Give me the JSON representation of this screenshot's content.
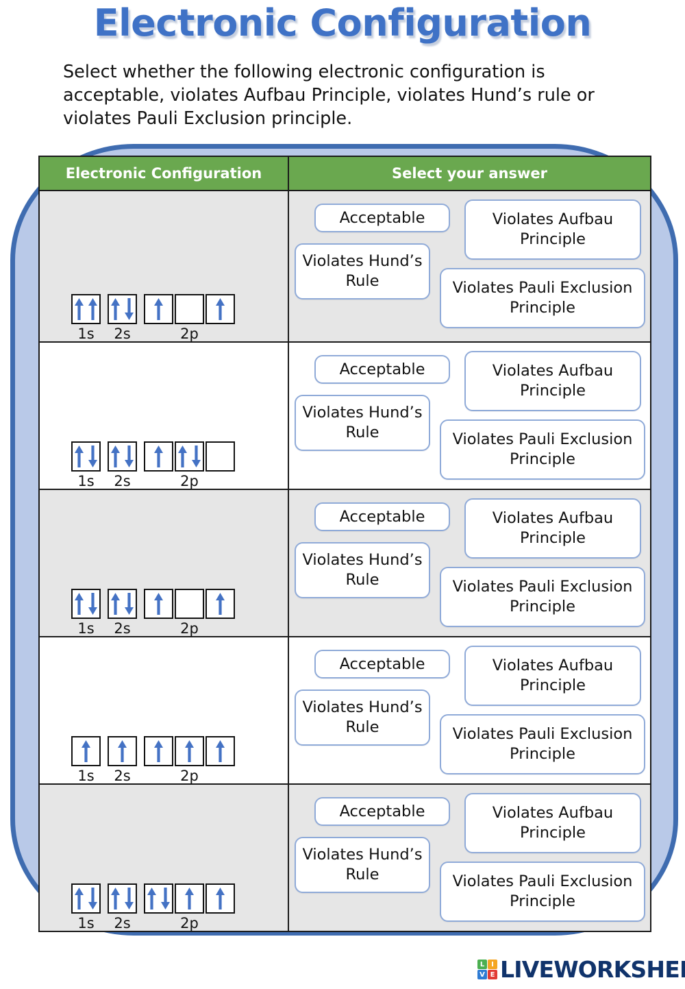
{
  "title": "Electronic Configuration",
  "instructions": "Select whether the following electronic configuration is acceptable, violates Aufbau Principle, violates Hund’s rule or violates Pauli Exclusion principle.",
  "table": {
    "headers": {
      "configuration": "Electronic Configuration",
      "answer": "Select your answer"
    }
  },
  "options": {
    "acceptable": "Acceptable",
    "hund": "Violates Hund’s Rule",
    "aufbau": "Violates Aufbau Principle",
    "pauli": "Violates Pauli Exclusion Principle"
  },
  "orbital_labels": {
    "s1": "1s",
    "s2": "2s",
    "p2": "2p"
  },
  "rows": [
    {
      "shade": "shaded",
      "groups": [
        {
          "label": "1s",
          "boxes": [
            "up-up"
          ]
        },
        {
          "label": "2s",
          "boxes": [
            "up-down"
          ]
        },
        {
          "label": "2p",
          "boxes": [
            "up",
            "empty",
            "up"
          ]
        }
      ]
    },
    {
      "shade": "plain",
      "groups": [
        {
          "label": "1s",
          "boxes": [
            "up-down"
          ]
        },
        {
          "label": "2s",
          "boxes": [
            "up-down"
          ]
        },
        {
          "label": "2p",
          "boxes": [
            "up",
            "up-down",
            "empty"
          ]
        }
      ]
    },
    {
      "shade": "shaded",
      "groups": [
        {
          "label": "1s",
          "boxes": [
            "up-down"
          ]
        },
        {
          "label": "2s",
          "boxes": [
            "up-down"
          ]
        },
        {
          "label": "2p",
          "boxes": [
            "up",
            "empty",
            "up"
          ]
        }
      ]
    },
    {
      "shade": "plain",
      "groups": [
        {
          "label": "1s",
          "boxes": [
            "up"
          ]
        },
        {
          "label": "2s",
          "boxes": [
            "up"
          ]
        },
        {
          "label": "2p",
          "boxes": [
            "up",
            "up",
            "up"
          ]
        }
      ]
    },
    {
      "shade": "shaded",
      "groups": [
        {
          "label": "1s",
          "boxes": [
            "up-down"
          ]
        },
        {
          "label": "2s",
          "boxes": [
            "up-down"
          ]
        },
        {
          "label": "2p",
          "boxes": [
            "up-down",
            "up",
            "up"
          ]
        }
      ]
    }
  ],
  "footer": {
    "logo_tiles": [
      "L",
      "I",
      "V",
      "E"
    ],
    "logo_text": "LIVEWORKSHEETS"
  },
  "colors": {
    "title_blue": "#3f72c6",
    "header_green": "#6aa84f",
    "arrow_blue": "#4472C4",
    "frame_blue": "#3f6cb0",
    "frame_fill": "#b9c9e8",
    "row_shade": "#e6e6e6",
    "button_border": "#8faad8",
    "logo_navy": "#10336b"
  }
}
